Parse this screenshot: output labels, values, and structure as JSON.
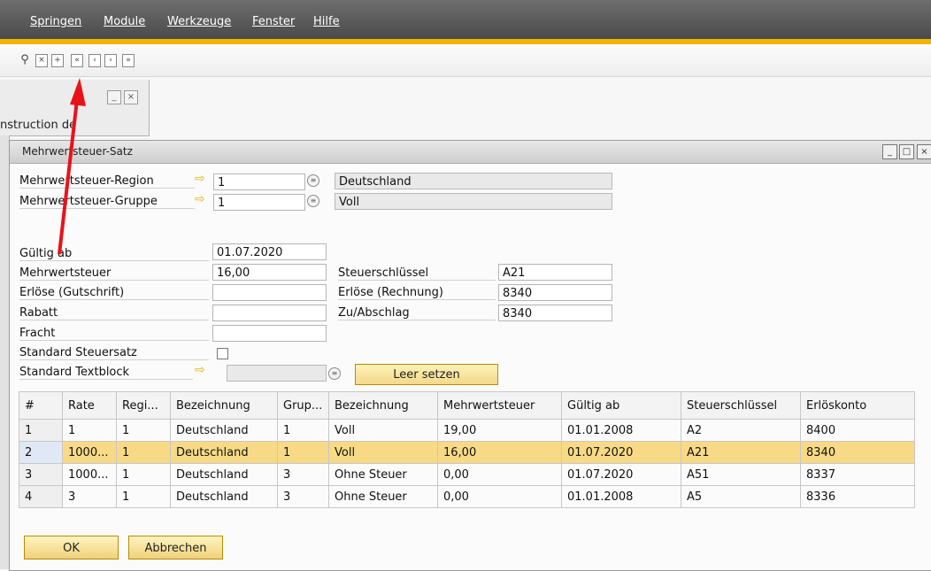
{
  "menu": [
    "Springen",
    "Module",
    "Werkzeuge",
    "Fenster",
    "Hilfe"
  ],
  "back_panel": {
    "label": "nstruction de"
  },
  "dialog": {
    "title": "Mehrwertsteuer-Satz",
    "region_label": "Mehrwertsteuer-Region",
    "region_value": "1",
    "region_name": "Deutschland",
    "group_label": "Mehrwertsteuer-Gruppe",
    "group_value": "1",
    "group_name": "Voll",
    "valid_from_label": "Gültig ab",
    "valid_from_value": "01.07.2020",
    "vat_label": "Mehrwertsteuer",
    "vat_value": "16,00",
    "tax_key_label": "Steuerschlüssel",
    "tax_key_value": "A21",
    "revenue_credit_label": "Erlöse (Gutschrift)",
    "revenue_credit_value": "",
    "revenue_invoice_label": "Erlöse (Rechnung)",
    "revenue_invoice_value": "8340",
    "discount_label": "Rabatt",
    "discount_value": "",
    "surcharge_label": "Zu/Abschlag",
    "surcharge_value": "8340",
    "freight_label": "Fracht",
    "freight_value": "",
    "std_rate_label": "Standard Steuersatz",
    "std_textblock_label": "Standard Textblock",
    "std_textblock_value": "",
    "clear_button": "Leer setzen",
    "ok_button": "OK",
    "cancel_button": "Abbrechen"
  },
  "table": {
    "headers": [
      "#",
      "Rate",
      "Regi...",
      "Bezeichnung",
      "Grup...",
      "Bezeichnung",
      "Mehrwertsteuer",
      "Gültig ab",
      "Steuerschlüssel",
      "Erlöskonto"
    ],
    "rows": [
      [
        "1",
        "1",
        "1",
        "Deutschland",
        "1",
        "Voll",
        "19,00",
        "01.01.2008",
        "A2",
        "8400"
      ],
      [
        "2",
        "1000...",
        "1",
        "Deutschland",
        "1",
        "Voll",
        "16,00",
        "01.07.2020",
        "A21",
        "8340"
      ],
      [
        "3",
        "1000...",
        "1",
        "Deutschland",
        "3",
        "Ohne Steuer",
        "0,00",
        "01.07.2020",
        "A51",
        "8337"
      ],
      [
        "4",
        "3",
        "1",
        "Deutschland",
        "3",
        "Ohne Steuer",
        "0,00",
        "01.01.2008",
        "A5",
        "8336"
      ]
    ],
    "selected_row": 1
  },
  "colors": {
    "accent": "#f2b300",
    "selection": "#f8da86",
    "annotation": "#e8121b"
  }
}
